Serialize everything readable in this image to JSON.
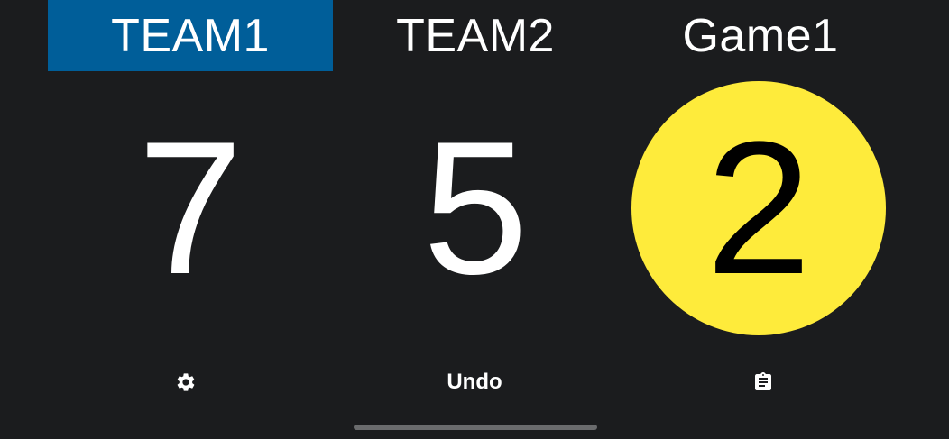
{
  "colors": {
    "background": "#1b1c1e",
    "team1_highlight": "#005e99",
    "game_circle": "#feeb3b",
    "text": "#ffffff",
    "nav_handle": "#6a6b6d"
  },
  "header": {
    "team1_name": "TEAM1",
    "team2_name": "TEAM2",
    "game_label": "Game1"
  },
  "scores": {
    "team1": "7",
    "team2": "5",
    "game_count": "2"
  },
  "actions": {
    "settings_icon": "gear-icon",
    "undo_label": "Undo",
    "clipboard_icon": "clipboard-list-icon"
  }
}
